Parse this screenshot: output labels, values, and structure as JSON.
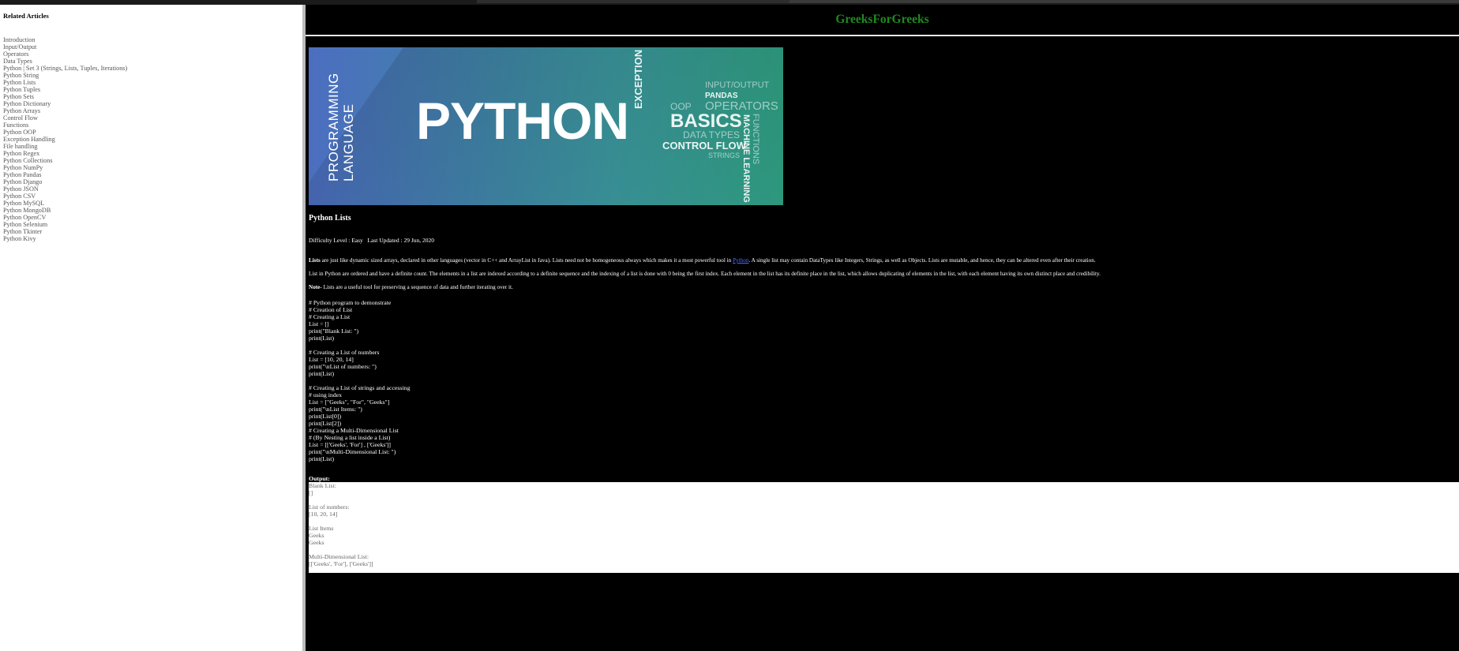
{
  "sidebar": {
    "title": "Related Articles",
    "items": [
      "Introduction",
      "Input/Output",
      "Operators",
      "Data Types",
      "Python | Set 3 (Strings, Lists, Tuples, Iterations)",
      "Python String",
      "Python Lists",
      "Python Tuples",
      "Python Sets",
      "Python Dictionary",
      "Python Arrays",
      "Control Flow",
      "Functions",
      "Python OOP",
      "Exception Handling",
      "File handling",
      "Python Regex",
      "Python Collections",
      "Python NumPy",
      "Python Pandas",
      "Python Django",
      "Python JSON",
      "Python CSV",
      "Python MySQL",
      "Python MongoDB",
      "Python OpenCV",
      "Python Selenium",
      "Python Tkinter",
      "Python Kivy"
    ]
  },
  "header": {
    "site_title": "GreeksForGreeks"
  },
  "banner": {
    "vertical_line1": "PROGRAMMING",
    "vertical_line2": "LANGUAGE",
    "main_word": "PYTHON",
    "words": {
      "exception": "EXCEPTION",
      "input_output": "INPUT/OUTPUT",
      "pandas": "PANDAS",
      "oop": "OOP",
      "operators": "OPERATORS",
      "basics": "BASICS",
      "data_types": "DATA TYPES",
      "control_flow": "CONTROL FLOW",
      "strings": "STRINGS",
      "functions": "FUNCTIONS",
      "machine_learning": "MACHINE LEARNING"
    }
  },
  "article": {
    "title": "Python Lists",
    "difficulty": "Difficulty Level : Easy   Last Updated : 29 Jun, 2020",
    "p1_bold": "Lists",
    "p1_text_a": " are just like dynamic sized arrays, declared in other languages (vector in C++ and ArrayList in Java). Lists need not be homogeneous always which makes it a most powerful tool in ",
    "p1_link": "Python",
    "p1_text_b": ". A single list may contain DataTypes like Integers, Strings, as well as Objects. Lists are mutable, and hence, they can be altered even after their creation.",
    "p2": "List in Python are ordered and have a definite count. The elements in a list are indexed according to a definite sequence and the indexing of a list is done with 0 being the first index. Each element in the list has its definite place in the list, which allows duplicating of elements in the list, with each element having its own distinct place and credibility.",
    "note_bold": "Note-",
    "note_text": " Lists are a useful tool for preserving a sequence of data and further iterating over it.",
    "code": "# Python program to demonstrate\n# Creation of List\n# Creating a List\nList = []\nprint(\"Blank List: \")\nprint(List)\n\n# Creating a List of numbers\nList = [10, 20, 14]\nprint(\"\\nList of numbers: \")\nprint(List)\n\n# Creating a List of strings and accessing\n# using index\nList = [\"Geeks\", \"For\", \"Geeks\"]\nprint(\"\\nList Items: \")\nprint(List[0])\nprint(List[2])\n# Creating a Multi-Dimensional List\n# (By Nesting a list inside a List)\nList = [['Geeks', 'For'] , ['Geeks']]\nprint(\"\\nMulti-Dimensional List: \")\nprint(List)",
    "output_label": "Output:",
    "output": "Blank List:\n[]\n\nList of numbers:\n[10, 20, 14]\n\nList Items\nGeeks\nGeeks\n\nMulti-Dimensional List:\n[['Geeks', 'For'], ['Geeks']]"
  }
}
